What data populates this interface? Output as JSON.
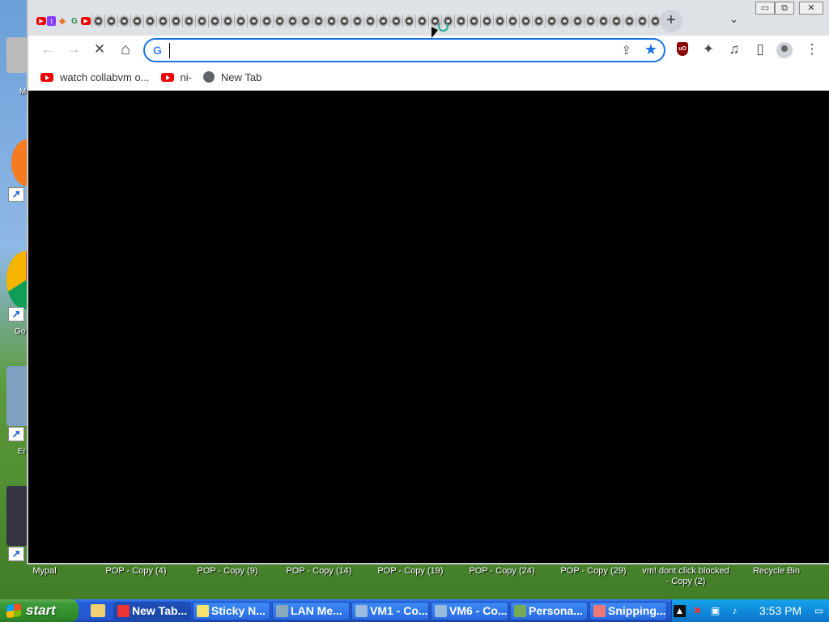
{
  "desktop": {
    "partial_labels": [
      "M",
      "Go",
      "Er"
    ],
    "icon_labels": [
      "Mypal",
      "POP - Copy (4)",
      "POP - Copy (9)",
      "POP - Copy (14)",
      "POP - Copy (19)",
      "POP - Copy (24)",
      "POP - Copy (29)",
      "vm! dont click blocked - Copy (2)",
      "Recycle Bin"
    ]
  },
  "browser": {
    "tabs": {
      "favicon_names": [
        "youtube-icon",
        "twitch-icon",
        "duckduckgo-icon",
        "google-icon",
        "youtube-icon",
        "ghost-icon"
      ],
      "repeated_ghost_tab_count_visible": 44,
      "new_tab_label": "+",
      "tab_search_label": "⌄"
    },
    "window_controls": {
      "minimize": "▭",
      "restore": "⧉",
      "close": "✕"
    },
    "toolbar": {
      "back": "←",
      "forward": "→",
      "stop": "✕",
      "home": "⌂",
      "omnibox_value": "",
      "omnibox_logo": "G",
      "share": "⇪",
      "bookmark_star": "★",
      "ublock": "uO",
      "extensions": "✦",
      "media": "♫",
      "sidepanel": "▯",
      "menu": "⋮"
    },
    "bookmarks": [
      {
        "label": "watch collabvm o...",
        "icon": "youtube-icon"
      },
      {
        "label": "ni-",
        "icon": "youtube-icon"
      },
      {
        "label": "New Tab",
        "icon": "globe-icon"
      }
    ]
  },
  "taskbar": {
    "start_label": "start",
    "tasks": [
      {
        "label": "New Tab...",
        "icon": "chrome-icon",
        "color": "#e33"
      },
      {
        "label": "Sticky N...",
        "icon": "sticky-notes-icon",
        "color": "#f5e36b"
      },
      {
        "label": "LAN Me...",
        "icon": "lan-messenger-icon",
        "color": "#8ab"
      },
      {
        "label": "VM1 - Co...",
        "icon": "vm-icon",
        "color": "#9bd"
      },
      {
        "label": "VM6 - Co...",
        "icon": "vm-icon",
        "color": "#9bd"
      },
      {
        "label": "Persona...",
        "icon": "personalization-icon",
        "color": "#7a5"
      },
      {
        "label": "Snipping...",
        "icon": "scissors-icon",
        "color": "#e77"
      }
    ],
    "clock": "3:53 PM"
  }
}
